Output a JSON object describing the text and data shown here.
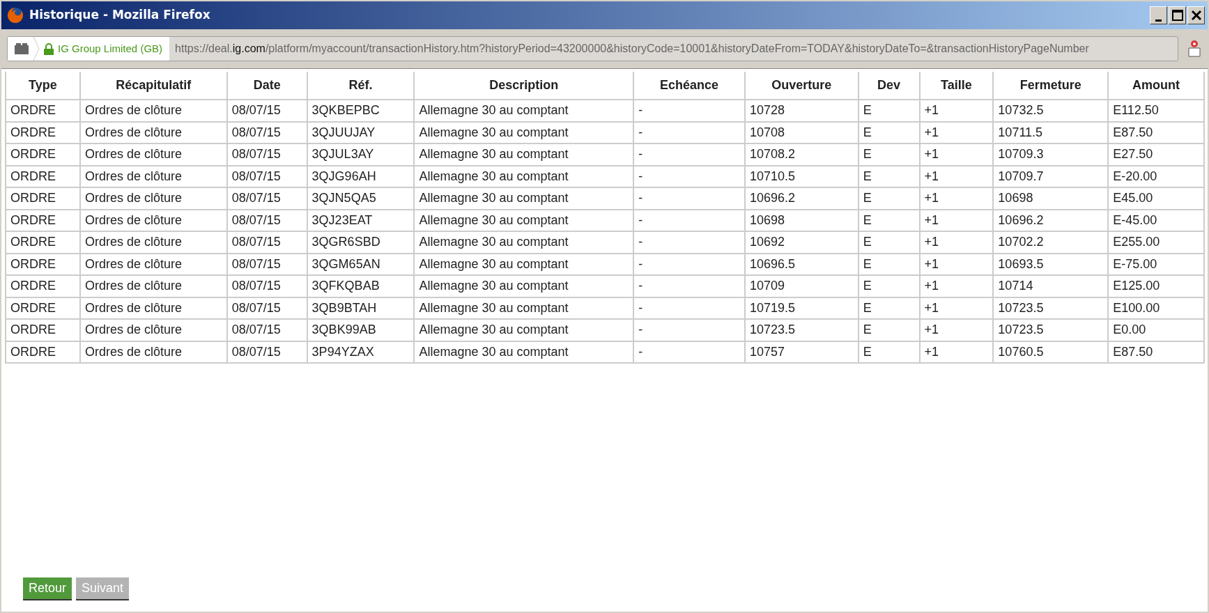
{
  "window": {
    "title": "Historique - Mozilla Firefox"
  },
  "address_bar": {
    "identity": "IG Group Limited (GB)",
    "url": [
      {
        "text": "https://deal.",
        "emphasis": false
      },
      {
        "text": "ig.com",
        "emphasis": true
      },
      {
        "text": "/platform/myaccount/transactionHistory.htm?historyPeriod=43200000&historyCode=10001&historyDateFrom=TODAY&historyDateTo=&transactionHistoryPageNumber",
        "emphasis": false
      }
    ]
  },
  "table": {
    "columns": [
      "Type",
      "Récapitulatif",
      "Date",
      "Réf.",
      "Description",
      "Echéance",
      "Ouverture",
      "Dev",
      "Taille",
      "Fermeture",
      "Amount"
    ],
    "rows": [
      [
        "ORDRE",
        "Ordres de clôture",
        "08/07/15",
        "3QKBEPBC",
        "Allemagne 30 au comptant",
        "-",
        "10728",
        "E",
        "+1",
        "10732.5",
        "E112.50"
      ],
      [
        "ORDRE",
        "Ordres de clôture",
        "08/07/15",
        "3QJUUJAY",
        "Allemagne 30 au comptant",
        "-",
        "10708",
        "E",
        "+1",
        "10711.5",
        "E87.50"
      ],
      [
        "ORDRE",
        "Ordres de clôture",
        "08/07/15",
        "3QJUL3AY",
        "Allemagne 30 au comptant",
        "-",
        "10708.2",
        "E",
        "+1",
        "10709.3",
        "E27.50"
      ],
      [
        "ORDRE",
        "Ordres de clôture",
        "08/07/15",
        "3QJG96AH",
        "Allemagne 30 au comptant",
        "-",
        "10710.5",
        "E",
        "+1",
        "10709.7",
        "E-20.00"
      ],
      [
        "ORDRE",
        "Ordres de clôture",
        "08/07/15",
        "3QJN5QA5",
        "Allemagne 30 au comptant",
        "-",
        "10696.2",
        "E",
        "+1",
        "10698",
        "E45.00"
      ],
      [
        "ORDRE",
        "Ordres de clôture",
        "08/07/15",
        "3QJ23EAT",
        "Allemagne 30 au comptant",
        "-",
        "10698",
        "E",
        "+1",
        "10696.2",
        "E-45.00"
      ],
      [
        "ORDRE",
        "Ordres de clôture",
        "08/07/15",
        "3QGR6SBD",
        "Allemagne 30 au comptant",
        "-",
        "10692",
        "E",
        "+1",
        "10702.2",
        "E255.00"
      ],
      [
        "ORDRE",
        "Ordres de clôture",
        "08/07/15",
        "3QGM65AN",
        "Allemagne 30 au comptant",
        "-",
        "10696.5",
        "E",
        "+1",
        "10693.5",
        "E-75.00"
      ],
      [
        "ORDRE",
        "Ordres de clôture",
        "08/07/15",
        "3QFKQBAB",
        "Allemagne 30 au comptant",
        "-",
        "10709",
        "E",
        "+1",
        "10714",
        "E125.00"
      ],
      [
        "ORDRE",
        "Ordres de clôture",
        "08/07/15",
        "3QB9BTAH",
        "Allemagne 30 au comptant",
        "-",
        "10719.5",
        "E",
        "+1",
        "10723.5",
        "E100.00"
      ],
      [
        "ORDRE",
        "Ordres de clôture",
        "08/07/15",
        "3QBK99AB",
        "Allemagne 30 au comptant",
        "-",
        "10723.5",
        "E",
        "+1",
        "10723.5",
        "E0.00"
      ],
      [
        "ORDRE",
        "Ordres de clôture",
        "08/07/15",
        "3P94YZAX",
        "Allemagne 30 au comptant",
        "-",
        "10757",
        "E",
        "+1",
        "10760.5",
        "E87.50"
      ]
    ]
  },
  "buttons": [
    {
      "label": "Retour",
      "disabled": false
    },
    {
      "label": "Suivant",
      "disabled": true
    }
  ]
}
